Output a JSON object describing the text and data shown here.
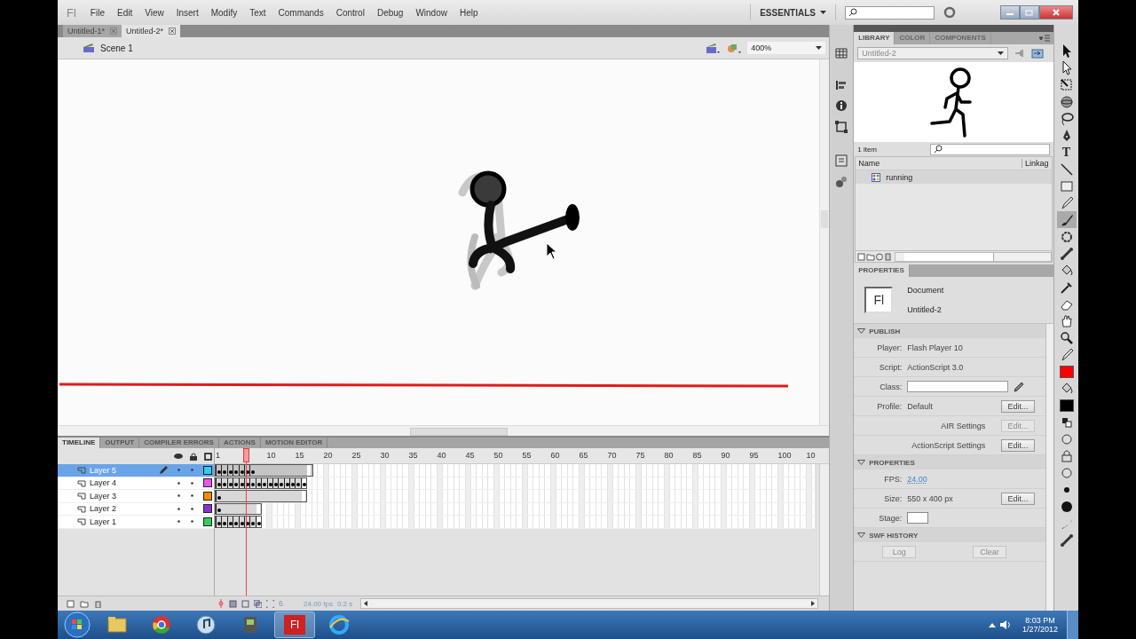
{
  "menubar": {
    "logo": "Fl",
    "items": [
      "File",
      "Edit",
      "View",
      "Insert",
      "Modify",
      "Text",
      "Commands",
      "Control",
      "Debug",
      "Window",
      "Help"
    ],
    "workspace": "ESSENTIALS"
  },
  "doc_tabs": [
    {
      "label": "Untitled-1*",
      "selected": false
    },
    {
      "label": "Untitled-2*",
      "selected": true
    }
  ],
  "scene": {
    "label": "Scene 1",
    "zoom": "400%"
  },
  "timeline": {
    "tabs": [
      {
        "label": "TIMELINE",
        "selected": true
      },
      {
        "label": "OUTPUT",
        "selected": false
      },
      {
        "label": "COMPILER ERRORS",
        "selected": false
      },
      {
        "label": "ACTIONS",
        "selected": false
      },
      {
        "label": "MOTION EDITOR",
        "selected": false
      }
    ],
    "ruler": [
      "1",
      "10",
      "15",
      "20",
      "25",
      "30",
      "35",
      "40",
      "45",
      "50",
      "55",
      "60",
      "65",
      "70",
      "75",
      "80",
      "85",
      "90",
      "95",
      "100",
      "10"
    ],
    "layers": [
      {
        "name": "Layer 5",
        "selected": true,
        "color": "#33ccee",
        "frames": [
          {
            "key": true
          },
          {
            "key": true
          },
          {
            "key": true
          },
          {
            "key": true
          },
          {
            "key": true
          },
          {
            "key": true
          },
          {
            "key": true
          },
          {
            "key": false
          },
          {
            "key": false
          },
          {
            "key": false
          },
          {
            "key": false
          },
          {
            "key": false
          },
          {
            "key": false
          },
          {
            "key": false
          },
          {
            "key": false
          },
          {
            "key": false
          },
          {
            "key": false
          }
        ]
      },
      {
        "name": "Layer 4",
        "selected": false,
        "color": "#ee55ee",
        "frames": [
          {
            "key": true
          },
          {
            "key": true
          },
          {
            "key": true
          },
          {
            "key": true
          },
          {
            "key": true
          },
          {
            "key": true
          },
          {
            "key": true
          },
          {
            "key": true
          },
          {
            "key": true
          },
          {
            "key": true
          },
          {
            "key": true
          },
          {
            "key": true
          },
          {
            "key": true
          },
          {
            "key": true
          },
          {
            "key": true
          },
          {
            "key": true
          }
        ]
      },
      {
        "name": "Layer 3",
        "selected": false,
        "color": "#ff8800",
        "frames": [
          {
            "key": true
          },
          {
            "key": false
          },
          {
            "key": false
          },
          {
            "key": false
          },
          {
            "key": false
          },
          {
            "key": false
          },
          {
            "key": false
          },
          {
            "key": false
          },
          {
            "key": false
          },
          {
            "key": false
          },
          {
            "key": false
          },
          {
            "key": false
          },
          {
            "key": false
          },
          {
            "key": false
          },
          {
            "key": false
          },
          {
            "key": false
          }
        ]
      },
      {
        "name": "Layer 2",
        "selected": false,
        "color": "#8833cc",
        "frames": [
          {
            "key": true
          },
          {
            "key": false
          },
          {
            "key": false
          },
          {
            "key": false
          },
          {
            "key": false
          },
          {
            "key": false
          },
          {
            "key": false
          },
          {
            "key": false
          }
        ]
      },
      {
        "name": "Layer 1",
        "selected": false,
        "color": "#33cc55",
        "frames": [
          {
            "key": true
          },
          {
            "key": true
          },
          {
            "key": true
          },
          {
            "key": true
          },
          {
            "key": true
          },
          {
            "key": true
          },
          {
            "key": true
          },
          {
            "key": true
          }
        ]
      }
    ],
    "current_frame": "6",
    "fps": "24.00 fps",
    "elapsed": "0.2 s"
  },
  "library": {
    "tabs": [
      {
        "label": "LIBRARY",
        "selected": true
      },
      {
        "label": "COLOR",
        "selected": false
      },
      {
        "label": "COMPONENTS",
        "selected": false
      }
    ],
    "document": "Untitled-2",
    "count": "1 item",
    "columns": [
      "Name",
      "Linkag"
    ],
    "items": [
      {
        "name": "running",
        "selected": true
      }
    ]
  },
  "properties": {
    "tab": "PROPERTIES",
    "doc_icon": "Fl",
    "doc_kind": "Document",
    "doc_name": "Untitled-2",
    "sections": [
      {
        "title": "PUBLISH",
        "expanded": true,
        "rows": [
          {
            "kind": "value",
            "label": "Player:",
            "value": "Flash Player 10"
          },
          {
            "kind": "value",
            "label": "Script:",
            "value": "ActionScript 3.0"
          },
          {
            "kind": "field",
            "label": "Class:"
          },
          {
            "kind": "value",
            "label": "Profile:",
            "value": "Default",
            "button": {
              "label": "Edit...",
              "disabled": false
            }
          },
          {
            "kind": "setting",
            "label": "AIR Settings",
            "button": {
              "label": "Edit...",
              "disabled": true
            }
          },
          {
            "kind": "setting",
            "label": "ActionScript Settings",
            "button": {
              "label": "Edit...",
              "disabled": false
            }
          }
        ]
      },
      {
        "title": "PROPERTIES",
        "expanded": true,
        "rows": [
          {
            "kind": "link",
            "label": "FPS:",
            "value": "24.00"
          },
          {
            "kind": "value",
            "label": "Size:",
            "value": "550 x 400 px",
            "button": {
              "label": "Edit...",
              "disabled": false
            }
          },
          {
            "kind": "swatch",
            "label": "Stage:",
            "color": "#ffffff"
          }
        ]
      },
      {
        "title": "SWF HISTORY",
        "expanded": true,
        "rows": [
          {
            "kind": "buttons",
            "buttons": [
              {
                "label": "Log",
                "disabled": true
              },
              {
                "label": "Clear",
                "disabled": true
              }
            ]
          }
        ]
      }
    ]
  },
  "tools": [
    {
      "kind": "select",
      "selected": false
    },
    {
      "kind": "subselect",
      "selected": false
    },
    {
      "kind": "transform",
      "selected": false
    },
    {
      "kind": "sphere",
      "selected": false
    },
    {
      "kind": "lasso",
      "selected": false
    },
    {
      "kind": "pen",
      "selected": false
    },
    {
      "kind": "text",
      "glyph": "T",
      "selected": false
    },
    {
      "kind": "line",
      "selected": false
    },
    {
      "kind": "rect",
      "selected": false
    },
    {
      "kind": "pencil",
      "selected": false
    },
    {
      "kind": "brush",
      "selected": true
    },
    {
      "kind": "deco",
      "selected": false
    },
    {
      "kind": "bone",
      "selected": false
    },
    {
      "kind": "bucket",
      "selected": false
    },
    {
      "kind": "dropper",
      "selected": false
    },
    {
      "kind": "eraser",
      "selected": false
    },
    {
      "kind": "hand",
      "selected": false
    },
    {
      "kind": "zoom",
      "selected": false
    },
    {
      "kind": "pencil",
      "selected": false
    },
    {
      "kind": "swatch",
      "color": "#ff0000",
      "selected": false
    },
    {
      "kind": "bucket",
      "selected": false
    },
    {
      "kind": "swatch",
      "color": "#000000",
      "selected": false
    },
    {
      "kind": "swap",
      "selected": false
    },
    {
      "kind": "circle",
      "selected": false
    },
    {
      "kind": "lock",
      "selected": false
    },
    {
      "kind": "circle",
      "selected": false
    },
    {
      "kind": "dot",
      "selected": false
    },
    {
      "kind": "bigdot",
      "selected": false
    },
    {
      "kind": "stroke",
      "selected": false
    },
    {
      "kind": "bone",
      "selected": false
    }
  ],
  "taskbar": {
    "apps": [
      {
        "kind": "folder",
        "active": false
      },
      {
        "kind": "chrome",
        "active": false
      },
      {
        "kind": "music",
        "active": false
      },
      {
        "kind": "tool",
        "active": false
      },
      {
        "kind": "flash",
        "label": "Fl",
        "active": true
      },
      {
        "kind": "ie",
        "active": false
      }
    ],
    "time": "8:03 PM",
    "date": "1/27/2012"
  }
}
